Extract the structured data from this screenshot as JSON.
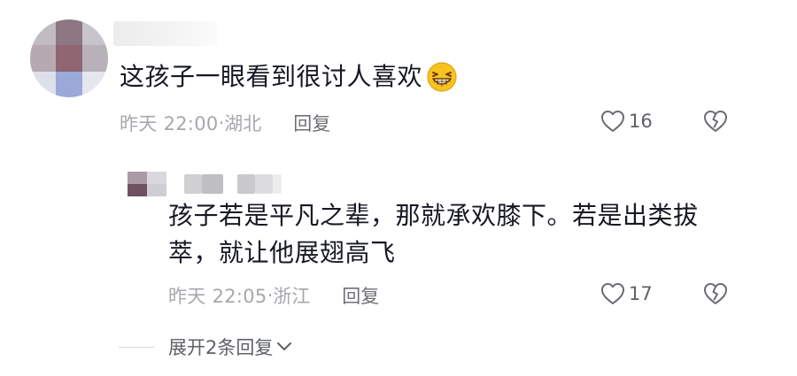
{
  "comment": {
    "text": "这孩子一眼看到很讨人喜欢",
    "emoji": "grinning-squint-emoji",
    "time": "昨天 22:00",
    "location": "湖北",
    "reply_label": "回复",
    "likes": "16"
  },
  "reply": {
    "text": "孩子若是平凡之辈，那就承欢膝下。若是出类拔萃，就让他展翅高飞",
    "time": "昨天 22:05",
    "location": "浙江",
    "reply_label": "回复",
    "likes": "17"
  },
  "expand": {
    "label": "展开2条回复"
  },
  "separator": "·",
  "colors": {
    "text_primary": "#161823",
    "text_meta": "#a6a8ad",
    "text_secondary": "#5f6168",
    "emoji_face": "#f7c31e"
  }
}
